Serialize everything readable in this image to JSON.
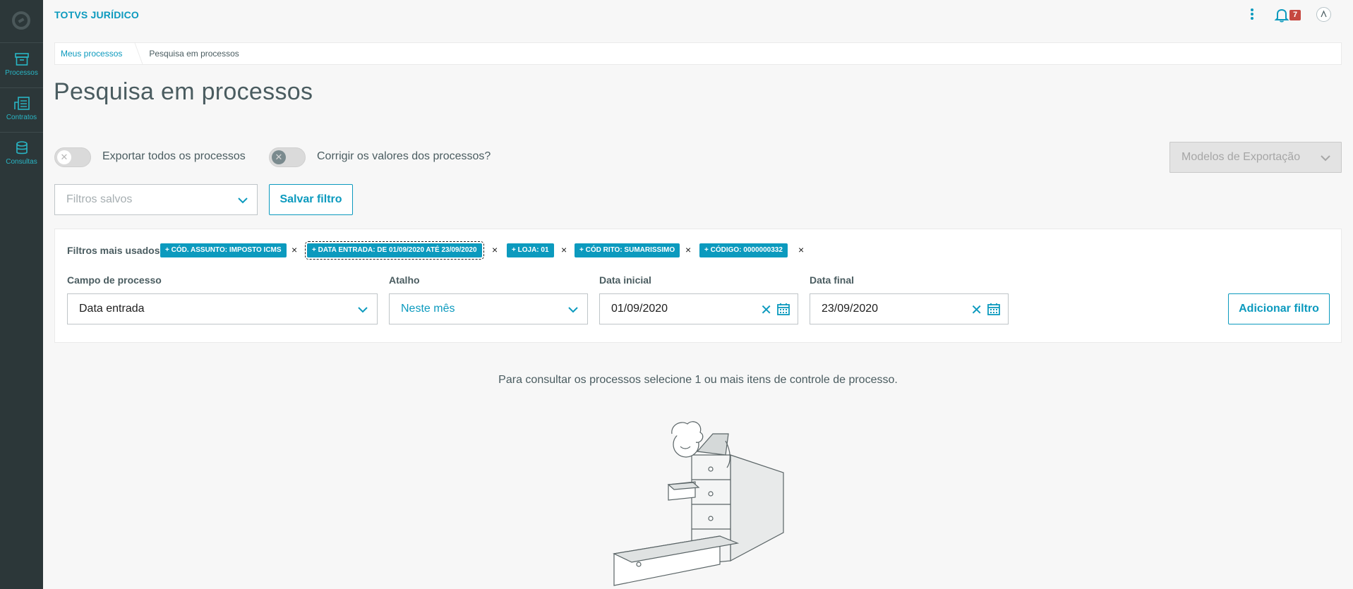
{
  "app": {
    "title": "TOTVS JURÍDICO"
  },
  "sidebar": {
    "items": [
      {
        "label": "Processos",
        "icon": "archive-icon"
      },
      {
        "label": "Contratos",
        "icon": "document-list-icon"
      },
      {
        "label": "Consultas",
        "icon": "database-icon"
      }
    ]
  },
  "header": {
    "notifications_count": "7"
  },
  "breadcrumb": {
    "items": [
      "Meus processos",
      "Pesquisa em processos"
    ]
  },
  "page": {
    "title": "Pesquisa em processos"
  },
  "switches": [
    {
      "label": "Exportar todos os processos",
      "checked": false
    },
    {
      "label": "Corrigir os valores dos processos?",
      "checked": false
    }
  ],
  "export_models": {
    "placeholder": "Modelos de Exportação"
  },
  "saved_filters": {
    "placeholder": "Filtros salvos",
    "save_label": "Salvar filtro"
  },
  "filters": {
    "label": "Filtros mais usados",
    "tags": [
      "+ CÓD. ASSUNTO: IMPOSTO ICMS",
      "+ DATA ENTRADA: DE 01/09/2020 ATÉ 23/09/2020",
      "+ LOJA: 01",
      "+ CÓD RITO: SUMARISSIMO",
      "+ CÓDIGO: 0000000332"
    ],
    "remove_symbol": "×"
  },
  "form": {
    "campo": {
      "label": "Campo de processo",
      "value": "Data entrada"
    },
    "atalho": {
      "label": "Atalho",
      "value": "Neste mês"
    },
    "data_inicial": {
      "label": "Data inicial",
      "value": "01/09/2020"
    },
    "data_final": {
      "label": "Data final",
      "value": "23/09/2020"
    },
    "add_label": "Adicionar filtro"
  },
  "empty_state": {
    "message": "Para consultar os processos selecione 1 ou mais itens de controle de processo."
  },
  "colors": {
    "primary": "#0c9abe",
    "sidebar": "#2c3739",
    "badge": "#c64840"
  }
}
